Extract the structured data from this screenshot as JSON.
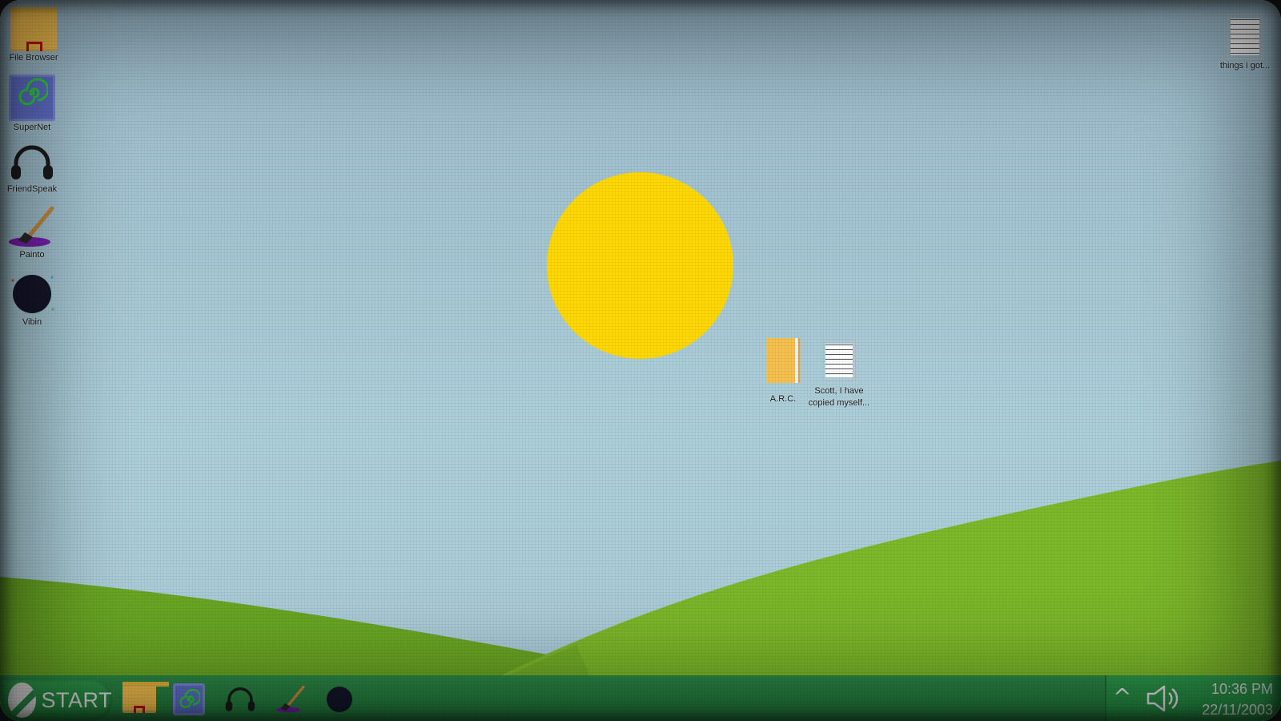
{
  "desktop": {
    "left_icons": [
      {
        "label": "File Browser",
        "icon": "folder-icon"
      },
      {
        "label": "SuperNet",
        "icon": "spiral-icon"
      },
      {
        "label": "FriendSpeak",
        "icon": "headphones-icon"
      },
      {
        "label": "Painto",
        "icon": "paintbrush-icon"
      },
      {
        "label": "Vibin",
        "icon": "dark-orb-icon"
      }
    ],
    "top_right_icon": {
      "label": "things i got...",
      "icon": "text-document-icon"
    },
    "center_icons": [
      {
        "label": "A.R.C.",
        "icon": "book-icon"
      },
      {
        "label": "Scott, I have copied myself...",
        "label_line1": "Scott, I have",
        "label_line2": "copied myself...",
        "icon": "text-document-icon"
      }
    ]
  },
  "taskbar": {
    "start_label": "START",
    "pinned": [
      "folder-icon",
      "spiral-icon",
      "headphones-icon",
      "paintbrush-icon",
      "dark-orb-icon"
    ],
    "tray": {
      "chevron": "^",
      "time": "10:36 PM",
      "date": "22/11/2003"
    }
  },
  "colors": {
    "sky": "#a6c8d4",
    "sun": "#ffd800",
    "hill_light": "#7cb82a",
    "hill_dark": "#5e9a20",
    "taskbar": "#237a3c"
  }
}
